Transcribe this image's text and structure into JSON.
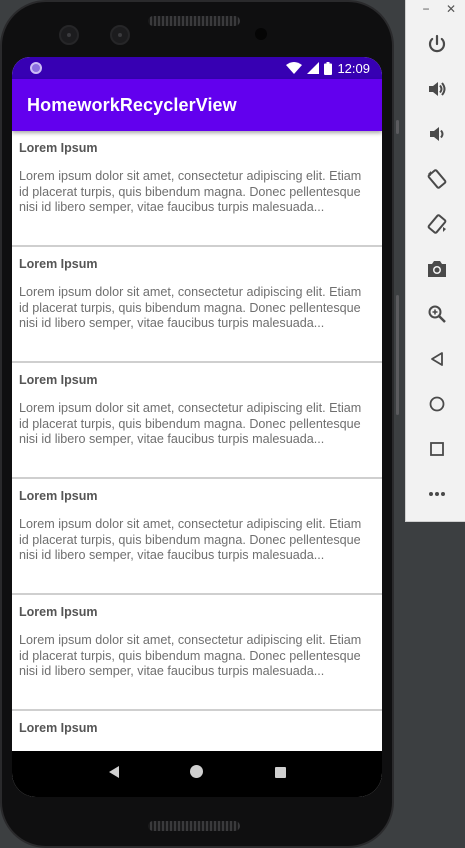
{
  "window_controls": {
    "minimize": "−",
    "close": "✕"
  },
  "status_bar": {
    "time": "12:09"
  },
  "app": {
    "title": "HomeworkRecyclerView"
  },
  "list": {
    "items": [
      {
        "title": "Lorem Ipsum",
        "body": "Lorem ipsum dolor sit amet, consectetur adipiscing elit. Etiam id placerat turpis, quis bibendum magna. Donec pellentesque nisi id libero semper, vitae faucibus turpis malesuada..."
      },
      {
        "title": "Lorem Ipsum",
        "body": "Lorem ipsum dolor sit amet, consectetur adipiscing elit. Etiam id placerat turpis, quis bibendum magna. Donec pellentesque nisi id libero semper, vitae faucibus turpis malesuada..."
      },
      {
        "title": "Lorem Ipsum",
        "body": "Lorem ipsum dolor sit amet, consectetur adipiscing elit. Etiam id placerat turpis, quis bibendum magna. Donec pellentesque nisi id libero semper, vitae faucibus turpis malesuada..."
      },
      {
        "title": "Lorem Ipsum",
        "body": "Lorem ipsum dolor sit amet, consectetur adipiscing elit. Etiam id placerat turpis, quis bibendum magna. Donec pellentesque nisi id libero semper, vitae faucibus turpis malesuada..."
      },
      {
        "title": "Lorem Ipsum",
        "body": "Lorem ipsum dolor sit amet, consectetur adipiscing elit. Etiam id placerat turpis, quis bibendum magna. Donec pellentesque nisi id libero semper, vitae faucibus turpis malesuada..."
      },
      {
        "title": "Lorem Ipsum",
        "body": ""
      }
    ]
  },
  "nav_bar": {
    "icons": [
      "back-icon",
      "home-icon",
      "recents-icon"
    ]
  },
  "toolbar": {
    "icons": [
      "power-icon",
      "volume-up-icon",
      "volume-down-icon",
      "rotate-left-icon",
      "rotate-right-icon",
      "camera-icon",
      "zoom-icon",
      "back-icon",
      "home-icon",
      "overview-icon",
      "more-icon"
    ]
  },
  "colors": {
    "status_bar": "#3700b3",
    "app_bar": "#6200ee",
    "toolbar_icon": "#4a4a4a"
  }
}
